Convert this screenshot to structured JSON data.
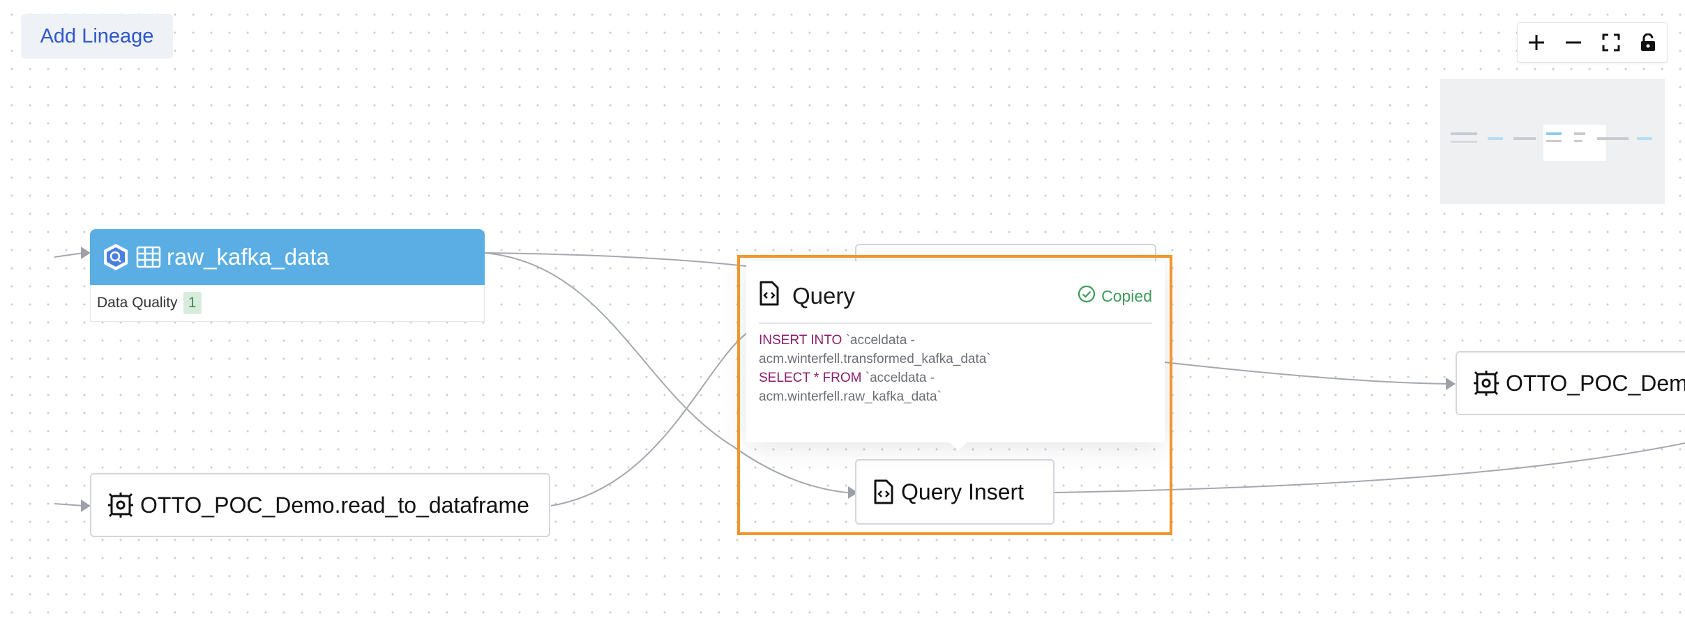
{
  "toolbar": {
    "add_lineage_label": "Add Lineage"
  },
  "canvas_controls": [
    {
      "name": "zoom-in-button",
      "icon": "plus-icon"
    },
    {
      "name": "zoom-out-button",
      "icon": "minus-icon"
    },
    {
      "name": "fit-view-button",
      "icon": "fit-view-icon"
    },
    {
      "name": "lock-button",
      "icon": "lock-icon"
    }
  ],
  "nodes": {
    "raw_kafka": {
      "title": "raw_kafka_data",
      "icons": [
        "bigquery-icon",
        "table-icon"
      ],
      "header_color": "#5aaee3",
      "data_quality_label": "Data Quality",
      "data_quality_count": "1"
    },
    "read_to_dataframe": {
      "title": "OTTO_POC_Demo.read_to_dataframe",
      "icon": "gear-chip-icon"
    },
    "query_insert": {
      "title": "Query Insert",
      "icon": "code-file-icon"
    },
    "otto_right": {
      "title": "OTTO_POC_Demo",
      "icon": "gear-chip-icon"
    }
  },
  "query_popup": {
    "title": "Query",
    "icon": "code-file-icon",
    "status_label": "Copied",
    "status_color": "#3e9b5a",
    "sql": {
      "kw1": "INSERT INTO",
      "line1": "`acceldata -",
      "line2": "acm.winterfell.transformed_kafka_data`",
      "kw2": "SELECT * FROM",
      "line3": "`acceldata -",
      "line4": "acm.winterfell.raw_kafka_data`"
    }
  },
  "colors": {
    "highlight": "#f0962e",
    "link": "#2f57c9"
  }
}
